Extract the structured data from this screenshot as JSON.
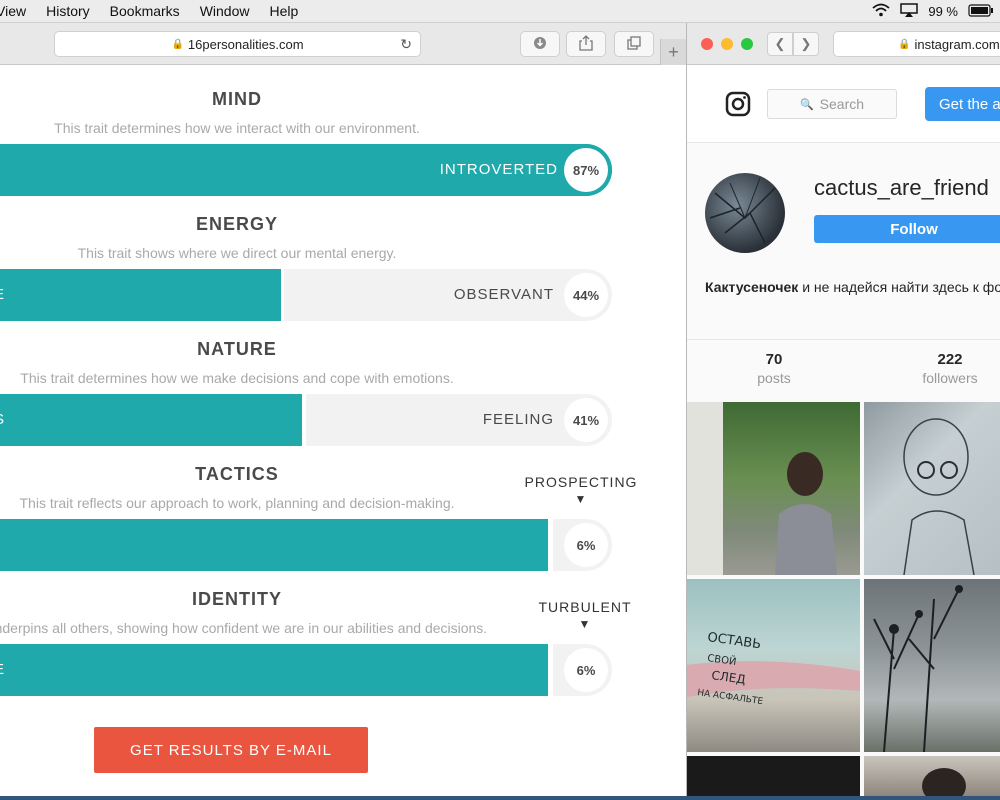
{
  "menubar": {
    "items": [
      "View",
      "History",
      "Bookmarks",
      "Window",
      "Help"
    ],
    "battery": "99 %"
  },
  "left_window": {
    "url": "16personalities.com",
    "plus": "+"
  },
  "traits": [
    {
      "title": "MIND",
      "description": "This trait determines how we interact with our environment.",
      "label": "INTROVERTED",
      "percent": "87%",
      "fill_fraction": 0.87,
      "label_side": "fill"
    },
    {
      "title": "ENERGY",
      "description": "This trait shows where we direct our mental energy.",
      "label_left": "E",
      "label": "OBSERVANT",
      "percent": "44%",
      "fill_fraction": 0.44,
      "label_side": "empty"
    },
    {
      "title": "NATURE",
      "description": "This trait determines how we make decisions and cope with emotions.",
      "label_left": "S",
      "label": "FEELING",
      "percent": "41%",
      "fill_fraction": 0.41,
      "label_side": "empty"
    },
    {
      "title": "TACTICS",
      "description": "This trait reflects our approach to work, planning and decision-making.",
      "marker": "PROSPECTING",
      "percent": "6%",
      "fill_fraction": 0.94
    },
    {
      "title": "IDENTITY",
      "description": "underpins all others, showing how confident we are in our abilities and decisions.",
      "label_left": "E",
      "marker": "TURBULENT",
      "percent": "6%",
      "fill_fraction": 0.94
    }
  ],
  "email_button": "GET RESULTS BY E-MAIL",
  "right_window": {
    "url": "instagram.com",
    "search_placeholder": "Search",
    "get_app": "Get the app",
    "username": "cactus_are_friend",
    "follow": "Follow",
    "bio_bold": "Кактусеночек",
    "bio_rest": " и не надейся найти здесь к фото.",
    "stats": [
      {
        "num": "70",
        "label": "posts"
      },
      {
        "num": "222",
        "label": "followers"
      }
    ],
    "photo_text": {
      "wall_line1": "ОСТАВЬ",
      "wall_line2": "СВОЙ",
      "wall_line3": "СЛЕД",
      "wall_line4": "НА АСФАЛЬТЕ"
    }
  }
}
